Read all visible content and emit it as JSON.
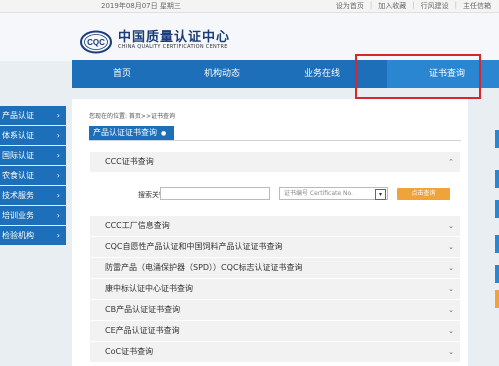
{
  "topbar": {
    "date": "2019年08月07日  星期三",
    "links": [
      "设为首页",
      "加入收藏",
      "行风建设",
      "主任信箱"
    ]
  },
  "header": {
    "logo_text": "CQC",
    "title_cn": "中国质量认证中心",
    "title_en": "CHINA QUALITY CERTIFICATION CENTRE"
  },
  "nav": {
    "items": [
      "首页",
      "机构动态",
      "业务在线",
      "证书查询"
    ],
    "active_index": 3
  },
  "sidebar": {
    "items": [
      "产品认证",
      "体系认证",
      "国际认证",
      "农食认证",
      "技术服务",
      "培训业务",
      "检验机构"
    ]
  },
  "breadcrumb": "您现在的位置:  首页>>证书查询",
  "section_title": "产品认证证书查询",
  "accordion": {
    "open_title": "CCC证书查询",
    "search_label": "搜索关键词:",
    "search_value": "",
    "select_value": "证书编号 Certificate No.",
    "search_button": "点击查询",
    "collapsed": [
      "CCC工厂信息查询",
      "CQC自愿性产品认证和中国饲料产品认证证书查询",
      "防雷产品（电涌保护器（SPD））CQC标志认证证书查询",
      "康中标认证中心证书查询",
      "CB产品认证证书查询",
      "CE产品认证证书查询",
      "CoC证书查询"
    ]
  },
  "colors": {
    "brand_blue": "#1c6fb8",
    "highlight_red": "#d9252c",
    "button_orange": "#f0a23b"
  }
}
